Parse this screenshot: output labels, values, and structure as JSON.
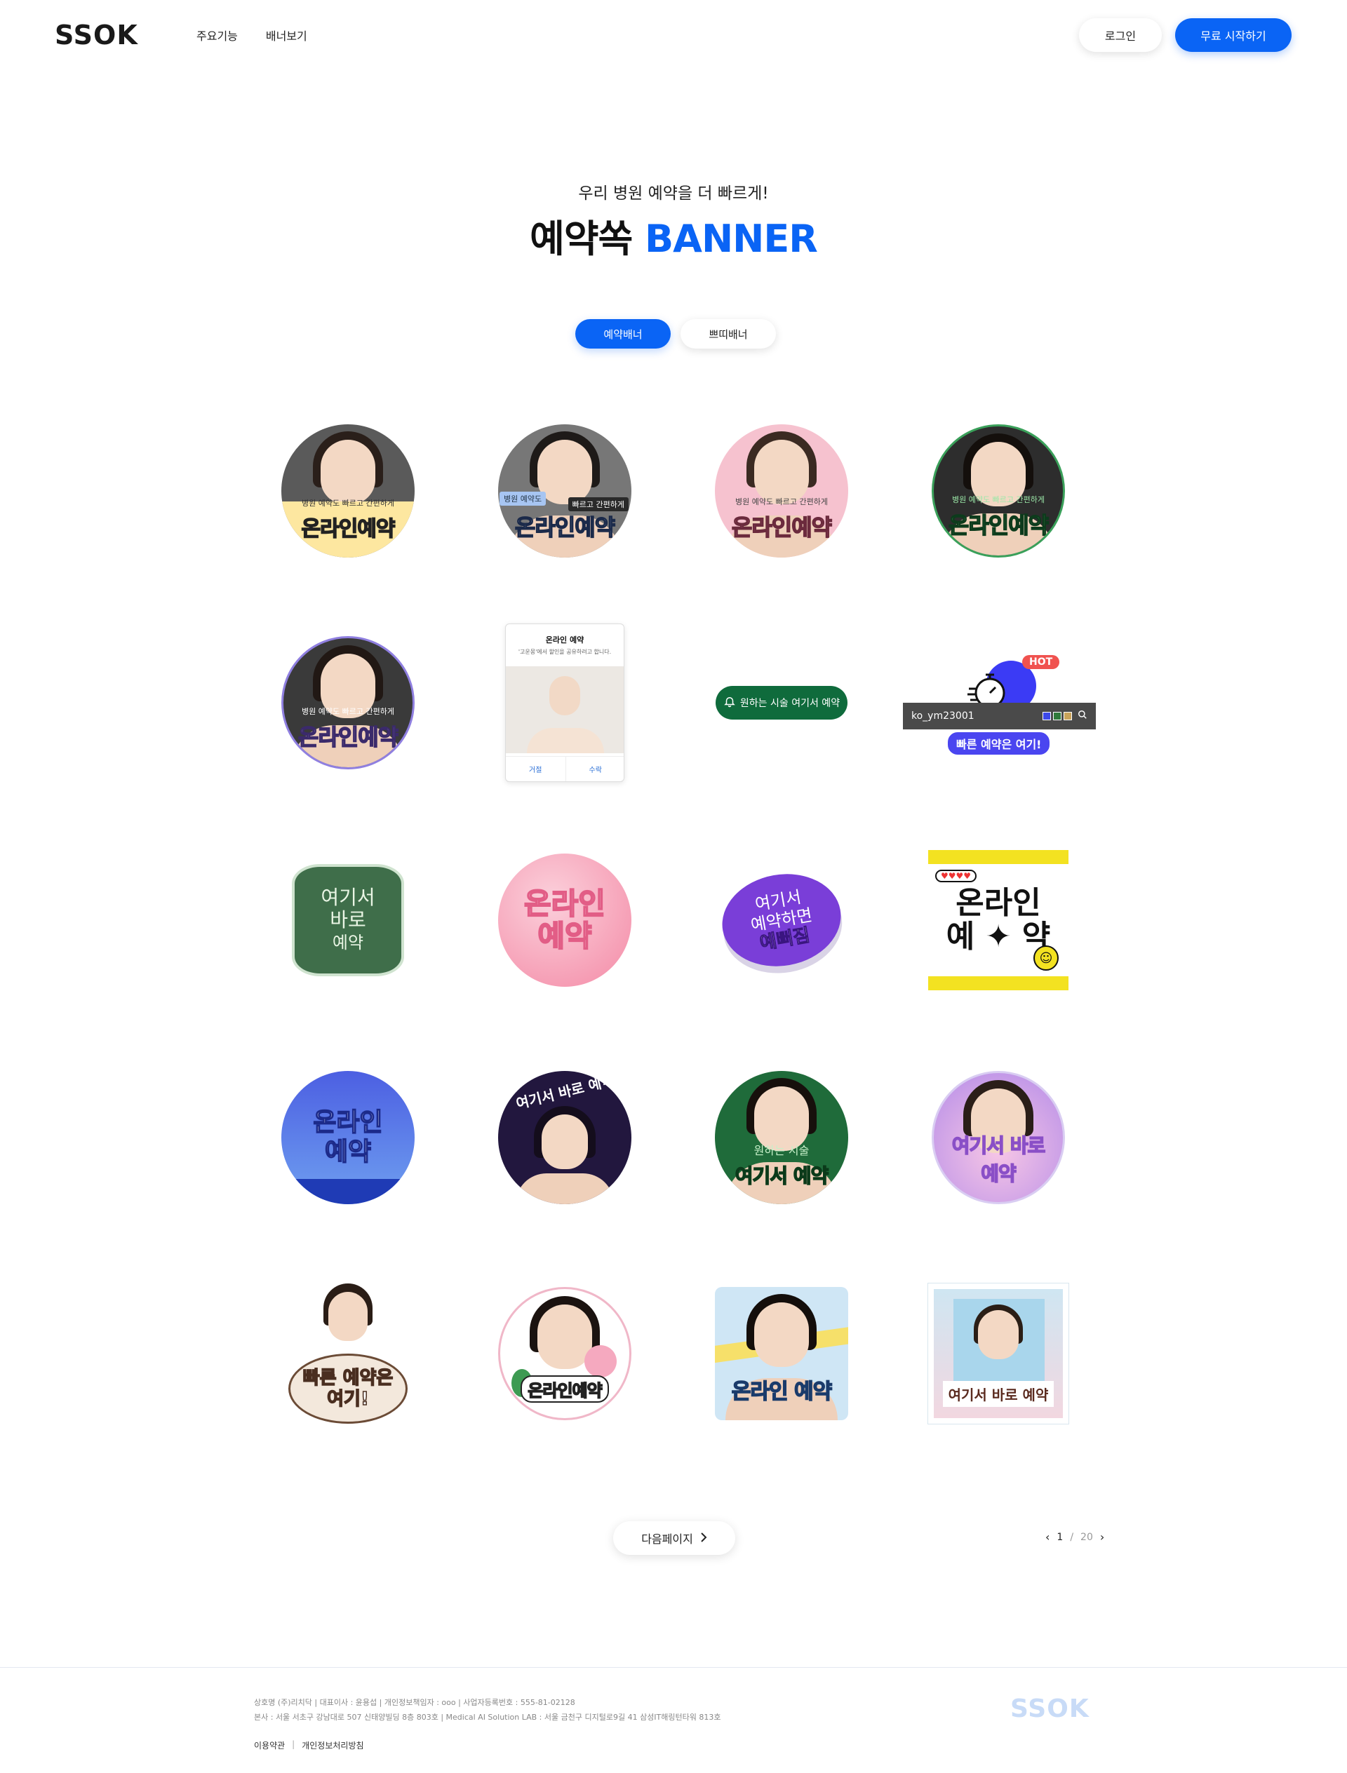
{
  "header": {
    "logo": "SSOK",
    "nav": [
      "주요기능",
      "배너보기"
    ],
    "login": "로그인",
    "start": "무료 시작하기"
  },
  "hero": {
    "subtitle": "우리 병원 예약을 더 빠르게!",
    "title_main": "예약쏙",
    "title_accent": "BANNER"
  },
  "tabs": [
    "예약배너",
    "쁘띠배너"
  ],
  "banners": {
    "b1": {
      "small": "병원 예약도 빠르고 간편하게",
      "big": "온라인예약"
    },
    "b2": {
      "tag1": "병원 예약도",
      "tag2": "빠르고 간편하게",
      "big": "온라인예약"
    },
    "b3": {
      "small": "병원 예약도 빠르고 간편하게",
      "big": "온라인예약"
    },
    "b4": {
      "small": "병원 예약도 빠르고 간편하게",
      "big": "온라인예약"
    },
    "b5": {
      "small": "병원 예약도 빠르고 간편하게",
      "big": "온라인예약"
    },
    "b6": {
      "title": "온라인 예약",
      "desc": "'고운몽'에서 할인을 공유하려고 합니다.",
      "reject": "거절",
      "accept": "수락"
    },
    "b7": {
      "text": "원하는 시술 여기서 예약"
    },
    "b8": {
      "hot": "HOT",
      "user": "ko_ym23001",
      "cta": "빠른 예약은 여기!"
    },
    "b9": {
      "l1": "여기서",
      "l2": "바로",
      "l3": "예약"
    },
    "b10": {
      "l1": "온라인",
      "l2": "예약"
    },
    "b11": {
      "l1": "여기서",
      "l2": "예약하면",
      "l3": "예뻐짐"
    },
    "b12": {
      "l1": "온라인",
      "l2": "예 ✦ 약"
    },
    "b13": {
      "l1": "온라인",
      "l2": "예약"
    },
    "b14": {
      "arc": "여기서 바로 예약"
    },
    "b15": {
      "small": "원하는 시술",
      "big": "여기서 예약"
    },
    "b16": {
      "l1": "여기서 바로",
      "l2": "예약"
    },
    "b17": {
      "l1": "빠른 예약은",
      "l2": "여기!"
    },
    "b18": {
      "big": "온라인예약"
    },
    "b19": {
      "big": "온라인 예약"
    },
    "b20": {
      "big": "여기서 바로 예약"
    }
  },
  "pagination": {
    "next_label": "다음페이지",
    "current": "1",
    "total": "20"
  },
  "footer": {
    "line1": "상호명 (주)리치닥  |  대표이사 : 윤용섭  |  개인정보책임자 : ooo  |  사업자등록번호 : 555-81-02128",
    "line2": "본사 : 서울 서초구 강남대로 507 신태양빌딩 8층 803호  |  Medical AI Solution LAB : 서울 금천구 디지털로9길 41 삼성IT해링턴타워 813호",
    "terms": "이용약관",
    "privacy": "개인정보처리방침",
    "logo": "SSOK"
  },
  "colors": {
    "accent": "#0a64f5",
    "green": "#0f6b3c",
    "purple": "#6a2bd6"
  }
}
